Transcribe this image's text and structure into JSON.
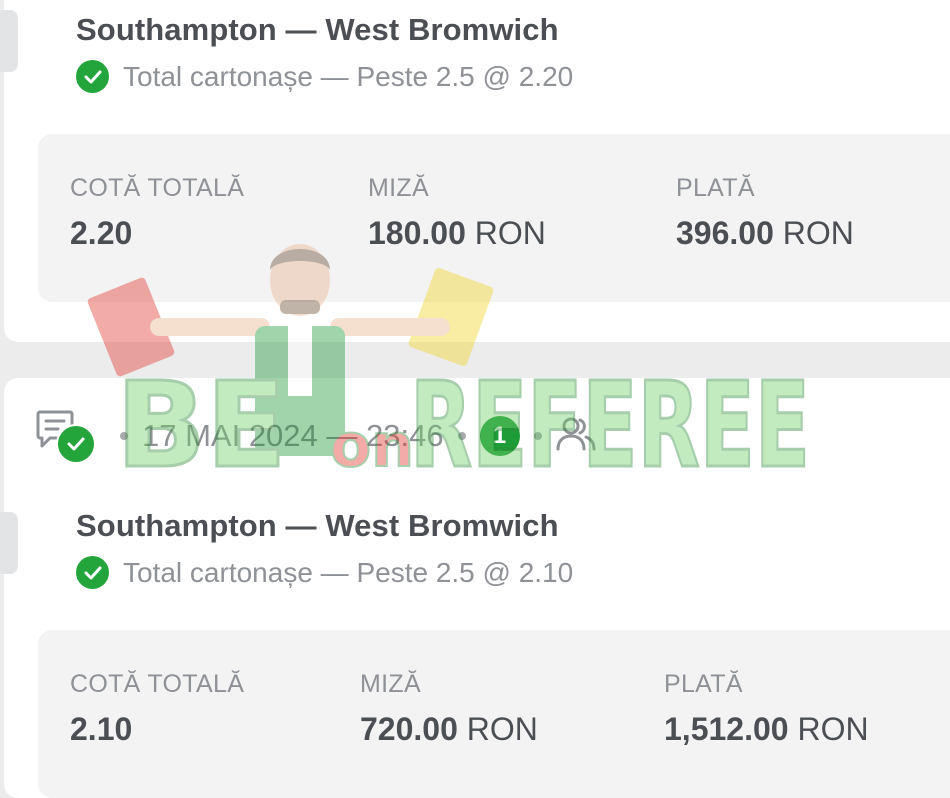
{
  "bets": [
    {
      "match": "Southampton — West Bromwich",
      "pick": "Total cartonașe — Peste 2.5 @ 2.20",
      "total_odds_label": "COTĂ TOTALĂ",
      "total_odds": "2.20",
      "stake_label": "MIZĂ",
      "stake_amount": "180.00",
      "stake_currency": "RON",
      "payout_label": "PLATĂ",
      "payout_amount": "396.00",
      "payout_currency": "RON"
    },
    {
      "datetime": "17 MAI 2024 — 23:46",
      "comment_count": "1",
      "match": "Southampton — West Bromwich",
      "pick": "Total cartonașe — Peste 2.5 @ 2.10",
      "total_odds_label": "COTĂ TOTALĂ",
      "total_odds": "2.10",
      "stake_label": "MIZĂ",
      "stake_amount": "720.00",
      "stake_currency": "RON",
      "payout_label": "PLATĂ",
      "payout_amount": "1,512.00",
      "payout_currency": "RON"
    }
  ],
  "watermark": {
    "text_left": "BE",
    "text_mid": "on",
    "text_right": "REFEREE"
  },
  "colors": {
    "success_green": "#23a53c",
    "card_bg": "#ffffff",
    "stats_bg": "#f3f3f4",
    "text_dark": "#4b4e53",
    "text_muted": "#8e9196"
  },
  "icons": [
    "check-circle-icon",
    "comment-icon",
    "users-icon"
  ]
}
